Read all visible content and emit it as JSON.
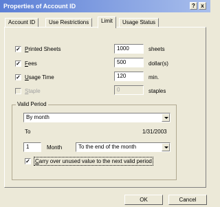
{
  "window": {
    "title": "Properties of Account ID",
    "help_label": "?",
    "close_label": "x"
  },
  "tabs": [
    {
      "label": "Account ID"
    },
    {
      "label": "Use Restrictions"
    },
    {
      "label": "Limit"
    },
    {
      "label": "Usage Status"
    }
  ],
  "limits": {
    "printed_sheets": {
      "checked": true,
      "label_underline": "P",
      "label_rest": "rinted Sheets",
      "value": "1000",
      "unit": "sheets"
    },
    "fees": {
      "checked": true,
      "label_underline": "F",
      "label_rest": "ees",
      "value": "500",
      "unit": "dollar(s)"
    },
    "usage_time": {
      "checked": true,
      "label_underline": "U",
      "label_rest": "sage Time",
      "value": "120",
      "unit": "min."
    },
    "staple": {
      "checked": false,
      "label_underline": "S",
      "label_rest": "taple",
      "value": "0",
      "unit": "staples"
    }
  },
  "valid_period": {
    "group_label": "Valid Period",
    "period_select": "By month",
    "to_label": "To",
    "to_date": "1/31/2003",
    "month_count": "1",
    "month_label": "Month",
    "end_select": "To the end of the month",
    "carry_over": {
      "checked": true,
      "label_underline": "C",
      "label_rest": "arry over unused value to the next valid period"
    }
  },
  "buttons": {
    "ok": "OK",
    "cancel": "Cancel"
  },
  "check_mark": "✓"
}
